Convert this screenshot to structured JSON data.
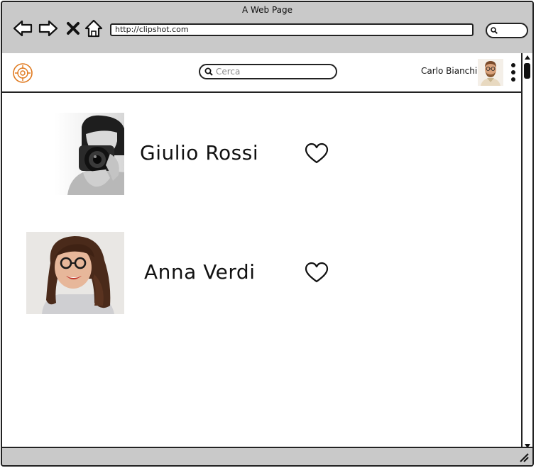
{
  "window": {
    "title": "A Web Page"
  },
  "browser": {
    "url": "http://clipshot.com",
    "nav": {
      "back": "back-arrow-icon",
      "forward": "forward-arrow-icon",
      "stop": "close-icon",
      "home": "home-icon"
    }
  },
  "header": {
    "logo_icon": "target-logo-icon",
    "search": {
      "placeholder": "Cerca",
      "value": ""
    },
    "user": {
      "name": "Carlo Bianchi"
    },
    "menu_icon": "kebab-menu-icon"
  },
  "people": [
    {
      "name": "Giulio Rossi",
      "like_icon": "heart-outline-icon"
    },
    {
      "name": "Anna Verdi",
      "like_icon": "heart-outline-icon"
    }
  ],
  "colors": {
    "accent": "#e07a1f",
    "chrome": "#c9c9c9",
    "ink": "#222222"
  }
}
